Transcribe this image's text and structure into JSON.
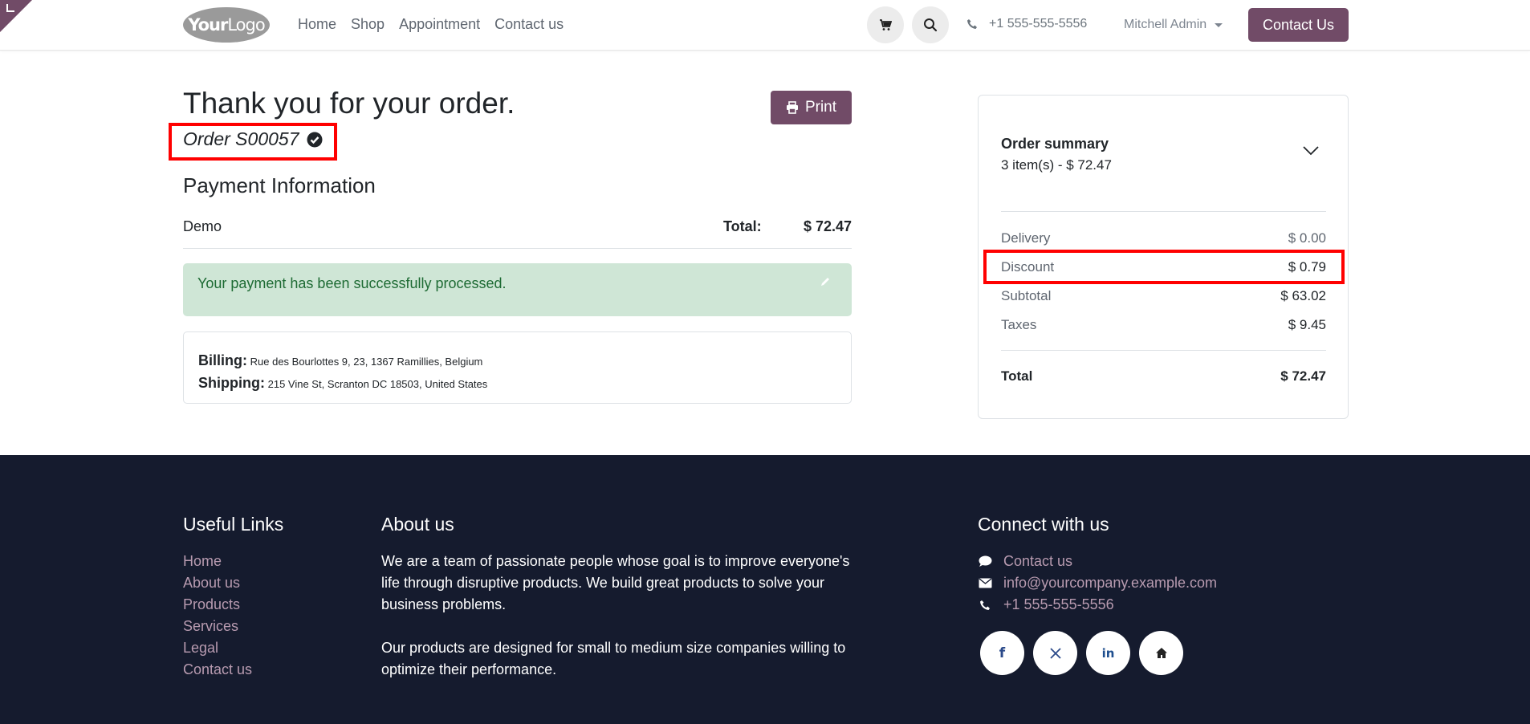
{
  "header": {
    "logo": {
      "bold": "Your",
      "light": "Logo"
    },
    "nav": [
      "Home",
      "Shop",
      "Appointment",
      "Contact us"
    ],
    "phone": "+1 555-555-5556",
    "user": "Mitchell Admin",
    "contact_button": "Contact Us"
  },
  "main": {
    "thanks": "Thank you for your order.",
    "order_ref": "Order S00057",
    "print_label": "Print",
    "payment_title": "Payment Information",
    "payment_method": "Demo",
    "total_label": "Total:",
    "total_value": "$ 72.47",
    "alert": "Your payment has been successfully processed.",
    "billing_label": "Billing:",
    "billing_address": "Rue des Bourlottes 9, 23, 1367 Ramillies, Belgium",
    "shipping_label": "Shipping:",
    "shipping_address": "215 Vine St, Scranton DC 18503, United States"
  },
  "summary": {
    "title": "Order summary",
    "subtitle": "3 item(s) -  $ 72.47",
    "rows": [
      {
        "label": "Delivery",
        "value": "$ 0.00"
      },
      {
        "label": "Discount",
        "value": "$ 0.79"
      },
      {
        "label": "Subtotal",
        "value": "$ 63.02"
      },
      {
        "label": "Taxes",
        "value": "$ 9.45"
      }
    ],
    "total_label": "Total",
    "total_value": "$ 72.47"
  },
  "footer": {
    "useful_links_title": "Useful Links",
    "useful_links": [
      "Home",
      "About us",
      "Products",
      "Services",
      "Legal",
      "Contact us"
    ],
    "about_title": "About us",
    "about_p1": "We are a team of passionate people whose goal is to improve everyone's life through disruptive products. We build great products to solve your business problems.",
    "about_p2": "Our products are designed for small to medium size companies willing to optimize their performance.",
    "connect_title": "Connect with us",
    "connect": [
      {
        "icon": "chat-icon",
        "label": "Contact us"
      },
      {
        "icon": "envelope-icon",
        "label": "info@yourcompany.example.com"
      },
      {
        "icon": "phone-icon",
        "label": "+1 555-555-5556"
      }
    ],
    "social": [
      "facebook-icon",
      "x-twitter-icon",
      "linkedin-icon",
      "home-icon"
    ]
  },
  "colors": {
    "brand": "#714b67",
    "footer_bg": "#151b2e",
    "alert_bg": "#cfe6d6",
    "highlight": "#ff0000"
  }
}
